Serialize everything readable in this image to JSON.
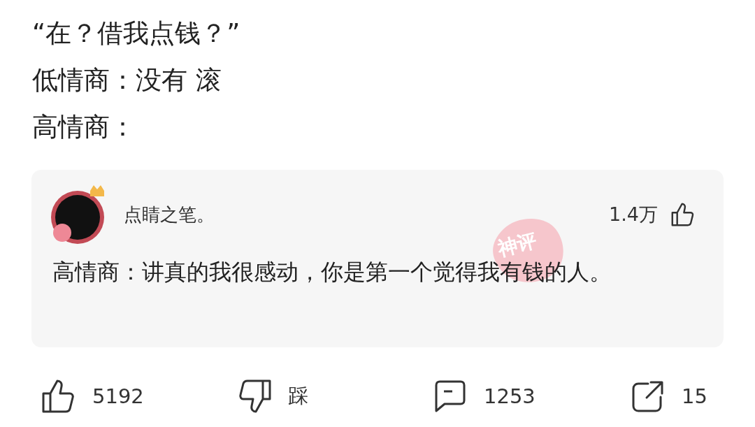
{
  "post": {
    "lines": [
      "“在？借我点钱？”",
      "低情商：没有 滚",
      "高情商："
    ]
  },
  "comment": {
    "author": "点睛之笔。",
    "likes": "1.4万",
    "badge": "神评",
    "text": "高情商：讲真的我很感动，你是第一个觉得我有钱的人。"
  },
  "actions": [
    {
      "kind": "like",
      "label": "5192"
    },
    {
      "kind": "dislike",
      "label": "踩"
    },
    {
      "kind": "comment",
      "label": "1253"
    },
    {
      "kind": "share",
      "label": "15"
    }
  ]
}
